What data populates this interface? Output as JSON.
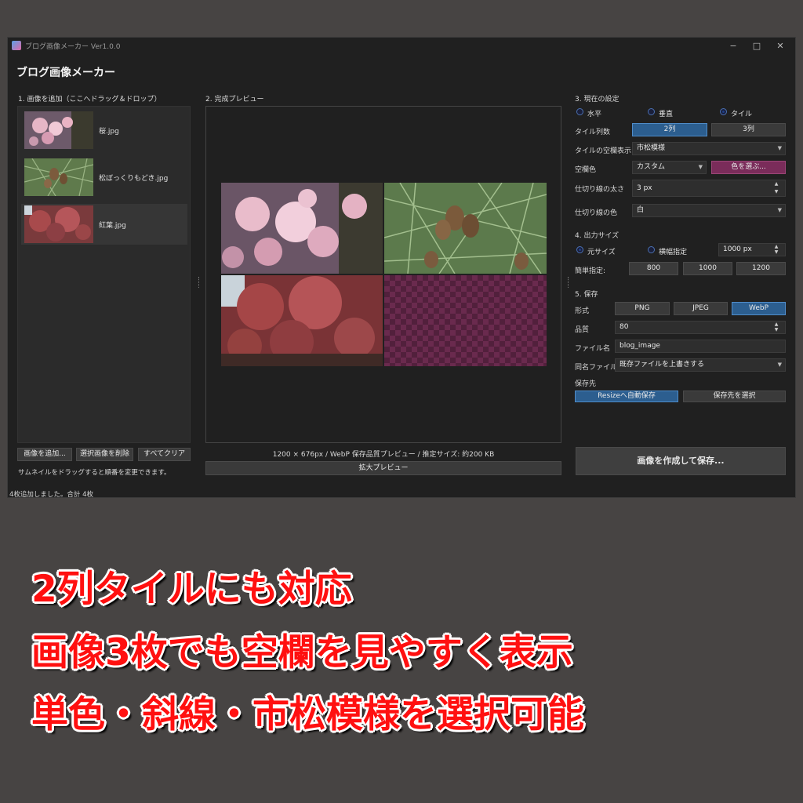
{
  "window": {
    "title": "ブログ画像メーカー Ver1.0.0",
    "controls": [
      "−",
      "□",
      "✕"
    ]
  },
  "app_heading": "ブログ画像メーカー",
  "left": {
    "section_label": "1. 画像を追加（ここへドラッグ＆ドロップ）",
    "thumbnails": [
      {
        "name": "桜.jpg"
      },
      {
        "name": "松ぼっくりもどき.jpg"
      },
      {
        "name": "紅葉.jpg"
      }
    ],
    "buttons": {
      "add": "画像を追加...",
      "delete": "選択画像を削除",
      "clear": "すべてクリア"
    },
    "hint": "サムネイルをドラッグすると順番を変更できます。"
  },
  "center": {
    "section_label": "2. 完成プレビュー",
    "info": "1200 × 676px / WebP 保存品質プレビュー / 推定サイズ: 約200 KB",
    "zoom_button": "拡大プレビュー"
  },
  "settings": {
    "section_label": "3. 現在の設定",
    "layout_options": [
      "水平",
      "垂直",
      "タイル"
    ],
    "layout_selected": "タイル",
    "tile_cols_label": "タイル列数",
    "tile_cols": [
      "2列",
      "3列"
    ],
    "tile_cols_selected": "2列",
    "empty_display_label": "タイルの空欄表示",
    "empty_display_value": "市松模様",
    "empty_color_label": "空欄色",
    "empty_color_value": "カスタム",
    "pick_color_button": "色を選ぶ...",
    "divider_width_label": "仕切り線の太さ",
    "divider_width_value": "3 px",
    "divider_color_label": "仕切り線の色",
    "divider_color_value": "白"
  },
  "output": {
    "section_label": "4. 出力サイズ",
    "size_options": [
      "元サイズ",
      "横幅指定"
    ],
    "size_selected": "元サイズ",
    "width_value": "1000 px",
    "quick_label": "簡単指定:",
    "quick_sizes": [
      "800",
      "1000",
      "1200"
    ]
  },
  "save": {
    "section_label": "5. 保存",
    "format_label": "形式",
    "formats": [
      "PNG",
      "JPEG",
      "WebP"
    ],
    "format_selected": "WebP",
    "quality_label": "品質",
    "quality_value": "80",
    "filename_label": "ファイル名",
    "filename_value": "blog_image",
    "same_name_label": "同名ファイル",
    "same_name_value": "既存ファイルを上書きする",
    "dest_label": "保存先",
    "dest_buttons": [
      "Resizeへ自動保存",
      "保存先を選択"
    ],
    "create_button": "画像を作成して保存..."
  },
  "status_bar": "4枚追加しました。合計 4枚",
  "captions": [
    "2列タイルにも対応",
    "画像3枚でも空欄を見やすく表示",
    "単色・斜線・市松模様を選択可能"
  ],
  "colors": {
    "accent": "#2c5e8f",
    "magenta": "#7a2c5a",
    "caption_red": "#ff1010",
    "checker_a": "#6a2a4e",
    "checker_b": "#52203c"
  }
}
